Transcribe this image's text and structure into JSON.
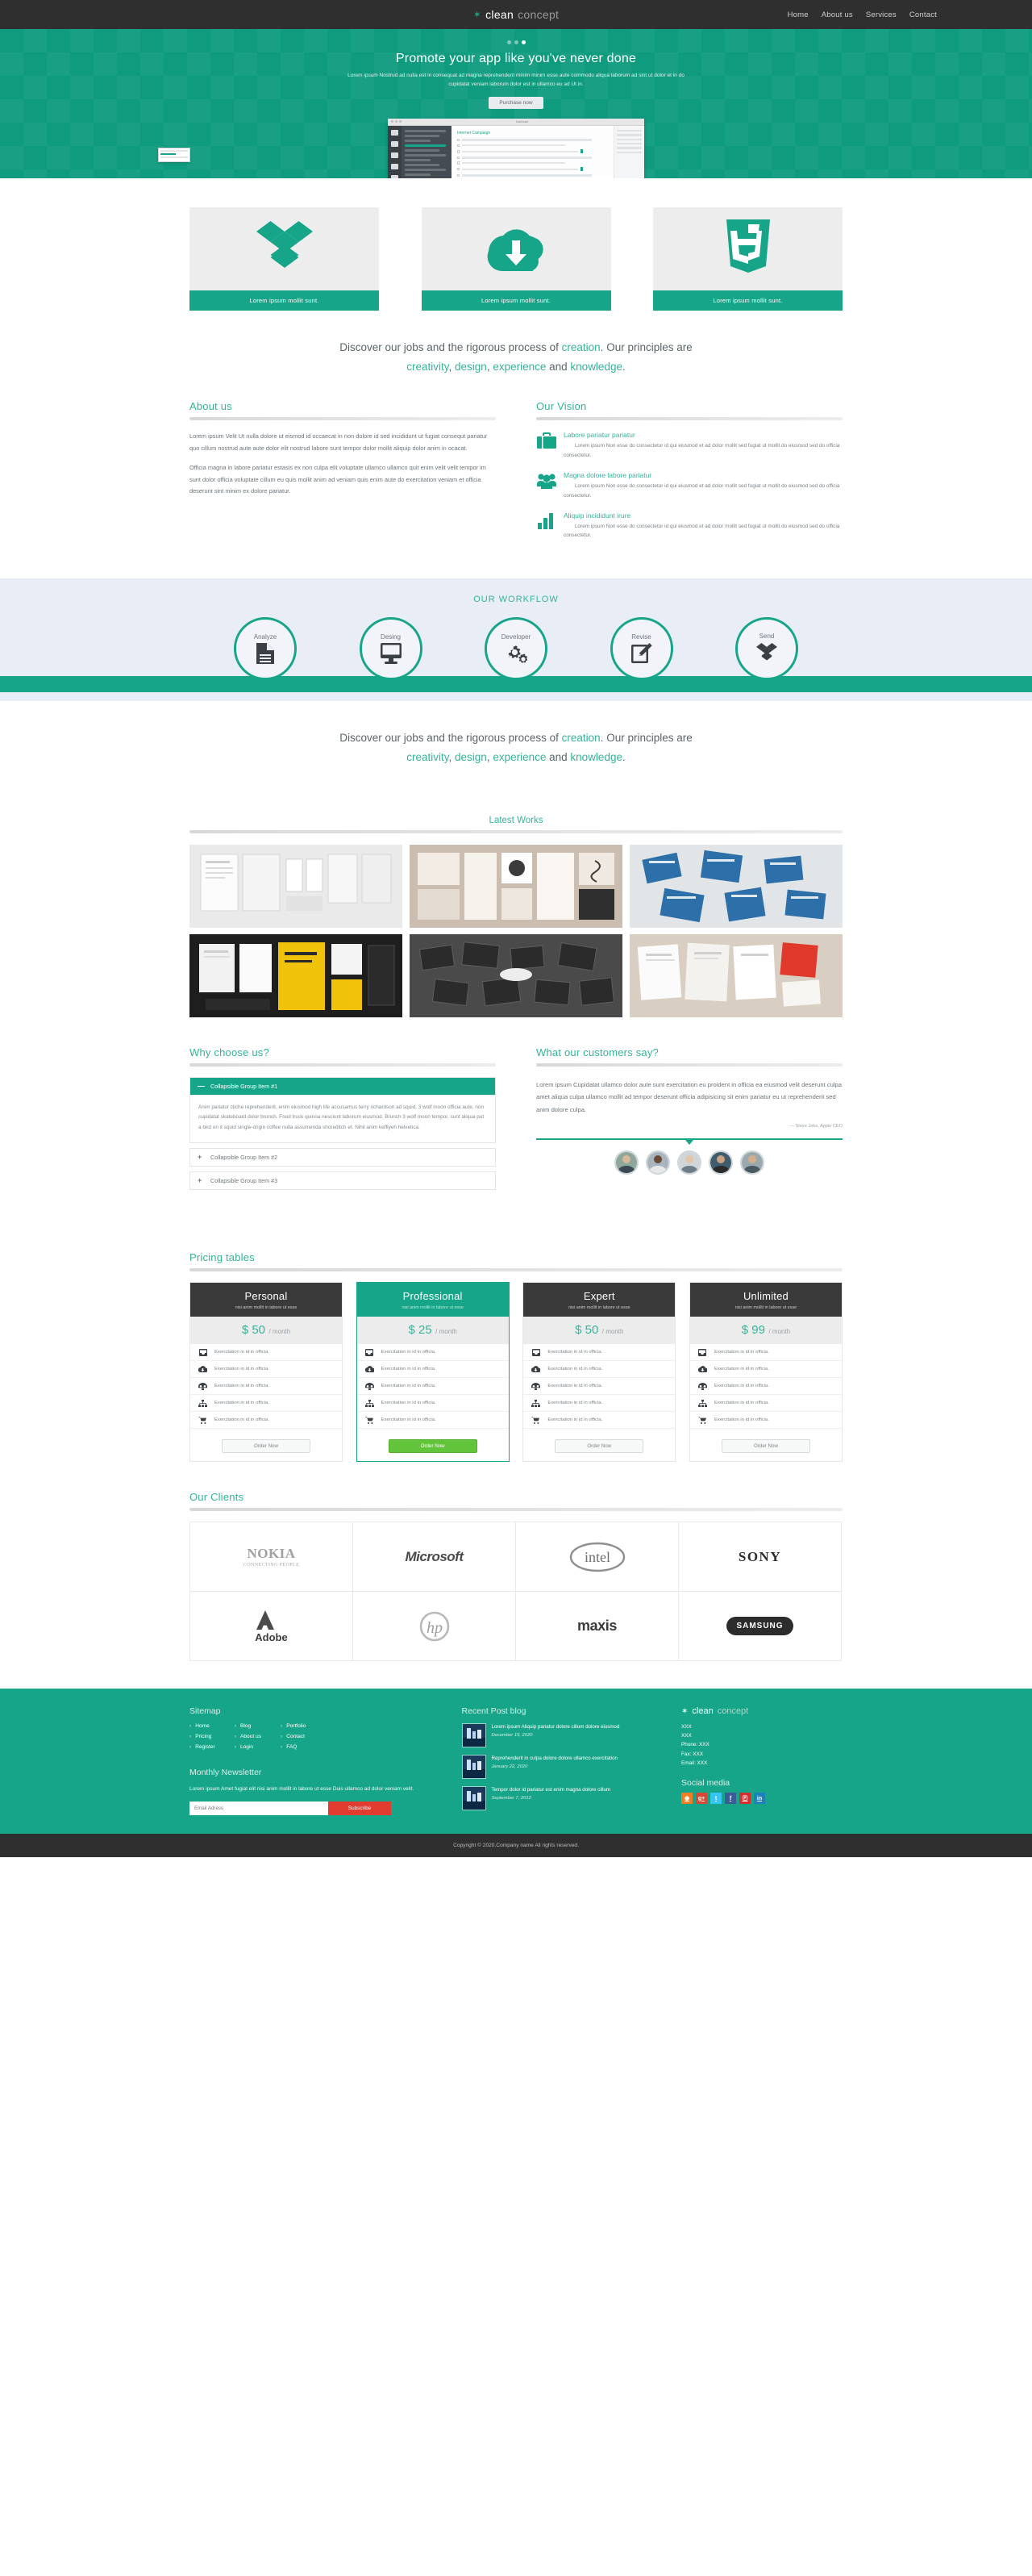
{
  "brand": {
    "icon": "gear-icon",
    "part1": "clean",
    "part2": "concept"
  },
  "nav": {
    "items": [
      "Home",
      "About us",
      "Services",
      "Contact"
    ]
  },
  "hero": {
    "dots": 3,
    "active_dot": 2,
    "title": "Promote your app like you've never done",
    "description": "Lorem ipsum Nostrud ad nulla est in consequat ad magna reprehenderit minim minim esse aute commodo aliqua laborum ad sint ut dolor et in do cupidatat veniam laborum dolor est in ullamco eu ad Ut in.",
    "button": "Purchase now",
    "mockup": {
      "window_title": "Dashboard",
      "panel_title": "Internet Campaign"
    }
  },
  "features": [
    {
      "icon": "dropbox-icon",
      "caption": "Lorem ipsum mollit sunt."
    },
    {
      "icon": "cloud-download-icon",
      "caption": "Lorem ipsum mollit sunt."
    },
    {
      "icon": "html5-icon",
      "caption": "Lorem ipsum mollit sunt."
    }
  ],
  "tagline": {
    "line1_a": "Discover our jobs and the rigorous process of ",
    "line1_g": "creation",
    "line1_b": ". Our principles are",
    "w1": "creativity",
    "s1": ", ",
    "w2": "design",
    "s2": ", ",
    "w3": "experience",
    "s3": " and ",
    "w4": "knowledge",
    "s4": "."
  },
  "about": {
    "title": "About us",
    "paragraphs": [
      "Lorem ipsum Velit Ut nulla dolore ut eismod id occaecat in non dolore id sed incididunt ut fugiat consequt pariatur quo cillum nostrud aute aute dolor elit nostrud labore sunt tempor dolor mollit aliquip dolor anim in ocacat.",
      "Officia magna in labore pariatur estasis ex non culpa elit voluptate ullamco ullamco quit enim velit velit tempor im sunt dolor officia voluptate cillum eu quis mollit anim ad veniam quis enim aute do exercitation veniam et officia deserunt sint minim ex dolore pariatur."
    ]
  },
  "vision": {
    "title": "Our Vision",
    "items": [
      {
        "icon": "briefcase-icon",
        "heading": "Labore pariatur pariatur",
        "text": "Lorem ipsum Non esse do consectetur id qui eiusmod et ad dolor mollit sed fugiat ut mollit do eiusmod sed do officia consectetur."
      },
      {
        "icon": "users-icon",
        "heading": "Magna dolore labore pariatur",
        "text": "Lorem ipsum Non esse do consectetur id qui eiusmod et ad dolor mollit sed fugiat ut mollit do eiusmod sed do officia consectetur."
      },
      {
        "icon": "bar-chart-icon",
        "heading": "Aliquip incididunt irure",
        "text": "Lorem ipsum Non esse do consectetur id qui eiusmod et ad dolor mollit sed fugiat ut mollit do eiusmod sed do officia consectetur."
      }
    ]
  },
  "workflow": {
    "title": "OUR WORKFLOW",
    "steps": [
      {
        "label": "Analyze",
        "icon": "document-icon"
      },
      {
        "label": "Desing",
        "icon": "monitor-icon"
      },
      {
        "label": "Developer",
        "icon": "gears-icon"
      },
      {
        "label": "Revise",
        "icon": "pencil-square-icon"
      },
      {
        "label": "Send",
        "icon": "dropbox-icon"
      }
    ]
  },
  "works": {
    "title": "Latest Works",
    "items": [
      {
        "name": "work-thumb-1"
      },
      {
        "name": "work-thumb-2"
      },
      {
        "name": "work-thumb-3"
      },
      {
        "name": "work-thumb-4"
      },
      {
        "name": "work-thumb-5"
      },
      {
        "name": "work-thumb-6"
      }
    ]
  },
  "why": {
    "title": "Why choose us?",
    "items": [
      {
        "label": "Collapsible Group Item #1",
        "sign": "—",
        "open": true,
        "body": "Anim pariatur cliche reprehenderit, enim eiusmod high life accusamus terry richardson ad squid. 3 wolf moon officia aute, non cupidatat skateboard dolor brunch. Food truck quinoa nesciunt laborum eiusmod. Brunch 3 wolf moon tempor, sunt aliqua put a bird on it squid single-origin coffee nulla assumenda shoreditch et. Nihil anim keffiyeh helvetica."
      },
      {
        "label": "Collapsible Group Item #2",
        "sign": "+",
        "open": false,
        "body": ""
      },
      {
        "label": "Collapsible Group Item #3",
        "sign": "+",
        "open": false,
        "body": ""
      }
    ]
  },
  "testimonial": {
    "title": "What our customers say?",
    "quote": "Lorem ipsum Cupidatat ullamco dolor aute sunt exercitation eu proident in officia ea eiusmod velit deserunt culpa amet aliqua culpa ullamco mollit ad tempor deserunt officia adipisicing sit enim pariatur eu ut reprehenderit sed anim dolore culpa.",
    "author": "— Steve Jobs, Apple CEO",
    "avatars": [
      "avatar-1",
      "avatar-2",
      "avatar-3",
      "avatar-4",
      "avatar-5"
    ]
  },
  "pricing": {
    "title": "Pricing tables",
    "subtitle": "nisi anim mollit in labore ut esse",
    "feature_label": "Exercitation in id in officia.",
    "order_label": "Order Now",
    "per": "/ month",
    "plans": [
      {
        "name": "Personal",
        "subtitle": "nisi anim mollit in labore ut esse",
        "price": "$ 50",
        "per": "/ month",
        "featured": false,
        "button": "Order Now",
        "features": [
          "Exercitation in id in officia.",
          "Exercitation in id in officia.",
          "Exercitation in id in officia.",
          "Exercitation in id in officia.",
          "Exercitation in id in officia."
        ]
      },
      {
        "name": "Professional",
        "subtitle": "nisi anim mollit in labore ut esse",
        "price": "$ 25",
        "per": "/ month",
        "featured": true,
        "button": "Order Now",
        "features": [
          "Exercitation in id in officia.",
          "Exercitation in id in officia.",
          "Exercitation in id in officia.",
          "Exercitation in id in officia.",
          "Exercitation in id in officia."
        ]
      },
      {
        "name": "Expert",
        "subtitle": "nisi anim mollit in labore ut esse",
        "price": "$ 50",
        "per": "/ month",
        "featured": false,
        "button": "Order Now",
        "features": [
          "Exercitation in id in officia.",
          "Exercitation in id in officia.",
          "Exercitation in id in officia.",
          "Exercitation in id in officia.",
          "Exercitation in id in officia."
        ]
      },
      {
        "name": "Unlimited",
        "subtitle": "nisi anim mollit in labore ut esse",
        "price": "$ 99",
        "per": "/ month",
        "featured": false,
        "button": "Order Now",
        "features": [
          "Exercitation in id in officia.",
          "Exercitation in id in officia.",
          "Exercitation in id in officia.",
          "Exercitation in id in officia.",
          "Exercitation in id in officia."
        ]
      }
    ],
    "feature_icons": [
      "inbox-icon",
      "cloud-download-icon",
      "dashboard-icon",
      "sitemap-icon",
      "cart-icon"
    ]
  },
  "clients": {
    "title": "Our Clients",
    "logos": [
      {
        "name": "nokia-logo",
        "text": "NOKIA",
        "sub": "CONNECTING PEOPLE"
      },
      {
        "name": "microsoft-logo",
        "text": "Microsoft",
        "sub": ""
      },
      {
        "name": "intel-logo",
        "text": "intel",
        "sub": ""
      },
      {
        "name": "sony-logo",
        "text": "SONY",
        "sub": ""
      },
      {
        "name": "adobe-logo",
        "text": "Adobe",
        "sub": ""
      },
      {
        "name": "hp-logo",
        "text": "hp",
        "sub": ""
      },
      {
        "name": "maxis-logo",
        "text": "maxis",
        "sub": ""
      },
      {
        "name": "samsung-logo",
        "text": "SAMSUNG",
        "sub": ""
      }
    ]
  },
  "footer": {
    "sitemap": {
      "title": "Sitemap",
      "col1": [
        "Home",
        "Pricing",
        "Register"
      ],
      "col2": [
        "Blog",
        "About us",
        "Login"
      ],
      "col3": [
        "Portfolio",
        "Contact",
        "FAQ"
      ]
    },
    "newsletter": {
      "title": "Monthly Newsletter",
      "text": "Lorem ipsum Amet fugiat elit nisi anim mollit in labore ut esse Duis ullamco ad dolor veniam velit.",
      "placeholder": "Email Adress",
      "button": "Subscribe"
    },
    "recent": {
      "title": "Recent Post blog",
      "posts": [
        {
          "text": "Lorem ipsum Aliquip pariatur dolore cillum dolore eiusmod",
          "date": "December 15, 2020"
        },
        {
          "text": "Reprehenderit in culpa dolore dolore ullamco exercitation",
          "date": "January 22, 2020"
        },
        {
          "text": "Tempor dolor id pariatur est enim magna dolore cillum",
          "date": "September 7, 2012"
        }
      ]
    },
    "contact": {
      "brand1": "clean",
      "brand2": "concept",
      "lines": [
        "XXX",
        "XXX",
        "Phone: XXX",
        "Fax: XXX",
        "Email: XXX"
      ],
      "social_title": "Social media",
      "social": [
        {
          "name": "rss-icon",
          "glyph": "◉",
          "color": "#f07d22"
        },
        {
          "name": "google-plus-icon",
          "glyph": "g+",
          "color": "#d64937"
        },
        {
          "name": "twitter-icon",
          "glyph": "t",
          "color": "#34c4f5"
        },
        {
          "name": "facebook-icon",
          "glyph": "f",
          "color": "#395b96"
        },
        {
          "name": "pinterest-icon",
          "glyph": "Ⓟ",
          "color": "#d42e30"
        },
        {
          "name": "linkedin-icon",
          "glyph": "in",
          "color": "#1b81b6"
        }
      ]
    },
    "copyright": "Copyright © 2020.Company name All rights reserved."
  },
  "colors": {
    "accent": "#17a589",
    "accent_light": "#35b39a",
    "dark": "#2f2f2f",
    "panel": "#e9edf5",
    "danger": "#e13c2f",
    "green_btn": "#62c43a"
  }
}
